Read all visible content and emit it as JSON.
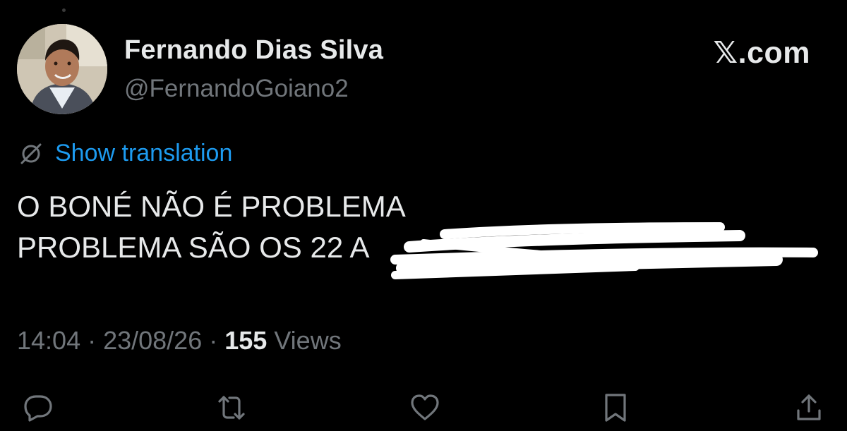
{
  "author": {
    "display_name": "Fernando Dias Silva",
    "handle": "@FernandoGoiano2",
    "avatar_icon": "profile-photo"
  },
  "brand": {
    "mark": "𝕏",
    "suffix": ".com"
  },
  "translation": {
    "icon": "translate-icon",
    "label": "Show translation",
    "color": "#1d9bf0"
  },
  "tweet": {
    "line1": "O BONÉ NÃO É PROBLEMA",
    "line2": "PROBLEMA SÃO OS 22 A"
  },
  "meta": {
    "time": "14:04",
    "separator": " · ",
    "date": "23/08/26",
    "views_count": "155",
    "views_label": " Views"
  },
  "actions": [
    {
      "name": "reply",
      "icon": "comment-icon"
    },
    {
      "name": "repost",
      "icon": "repost-icon"
    },
    {
      "name": "like",
      "icon": "heart-icon"
    },
    {
      "name": "bookmark",
      "icon": "bookmark-icon"
    },
    {
      "name": "share",
      "icon": "share-icon"
    }
  ],
  "colors": {
    "background": "#000000",
    "text_primary": "#e7e9ea",
    "text_secondary": "#71767b",
    "link": "#1d9bf0"
  }
}
